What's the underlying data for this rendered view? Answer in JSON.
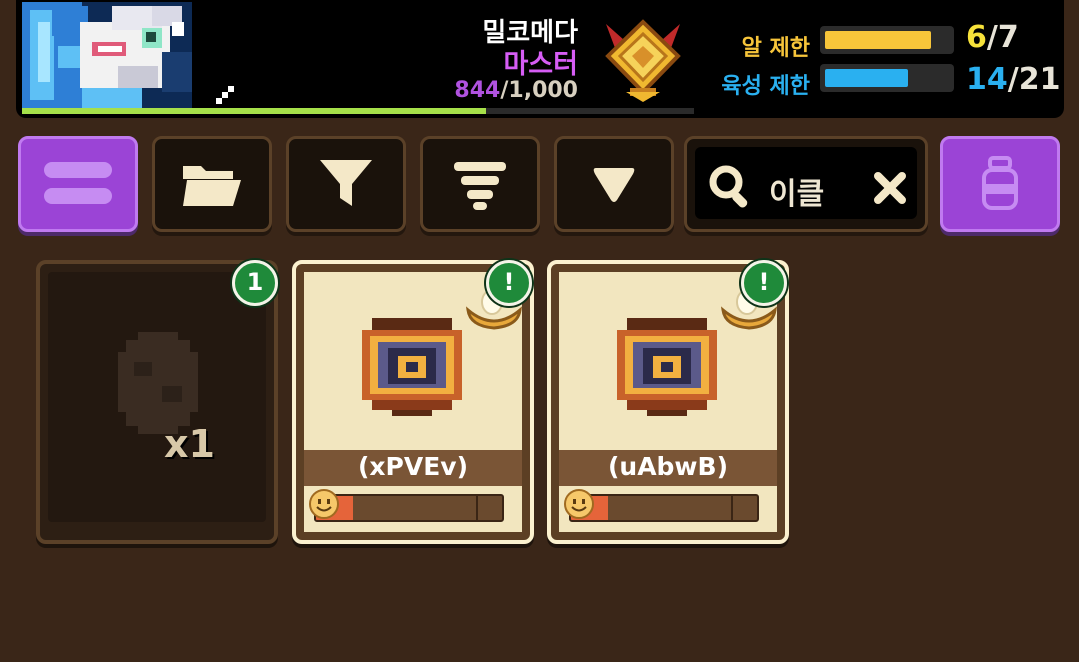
{
  "player": {
    "name": "밀코메다",
    "title": "마스터",
    "exp_current": "844",
    "exp_separator": "/",
    "exp_max": "1,000",
    "exp_progress": 0.69
  },
  "limits": {
    "egg": {
      "label": "알 제한",
      "current": "6",
      "separator": "/",
      "max": "7",
      "progress": 0.857,
      "color": "#f7c53a"
    },
    "raise": {
      "label": "육성 제한",
      "current": "14",
      "separator": "/",
      "max": "21",
      "progress": 0.667,
      "color": "#2ab0f0"
    }
  },
  "toolbar": {
    "menu_icon": "menu-icon",
    "folder_icon": "folder-icon",
    "filter_icon": "filter-icon",
    "sort_icon": "sort-icon",
    "dropdown_icon": "triangle-down-icon",
    "search_icon": "search-icon",
    "search_text": "이클",
    "clear_icon": "close-icon",
    "potion_icon": "potion-icon"
  },
  "cards": {
    "egg": {
      "notification": "1",
      "count": "x1"
    },
    "pets": [
      {
        "name": "(xPVEv)",
        "notification": "!",
        "mood": 0.2
      },
      {
        "name": "(uAbwB)",
        "notification": "!",
        "mood": 0.2
      }
    ]
  },
  "colors": {
    "background": "#3a2618",
    "purple_button": "#9b44d6",
    "exp_text": "#b052e0",
    "notification": "#1f8a3a"
  }
}
